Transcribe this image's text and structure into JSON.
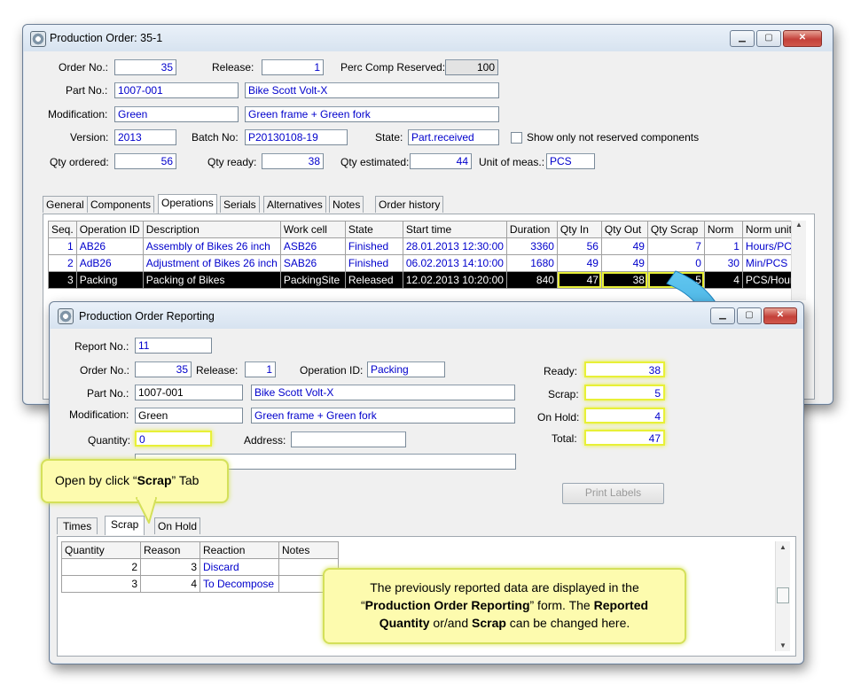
{
  "main_window": {
    "title": "Production Order: 35-1",
    "labels": {
      "order_no": "Order No.:",
      "release": "Release:",
      "perc_comp_reserved": "Perc Comp Reserved:",
      "part_no": "Part No.:",
      "modification": "Modification:",
      "version": "Version:",
      "batch_no": "Batch No:",
      "state": "State:",
      "show_only": "Show only not reserved components",
      "qty_ordered": "Qty ordered:",
      "qty_ready": "Qty ready:",
      "qty_estimated": "Qty estimated:",
      "unit_of_meas": "Unit of meas.:"
    },
    "values": {
      "order_no": "35",
      "release": "1",
      "perc_comp_reserved": "100",
      "part_no": "1007-001",
      "part_desc": "Bike Scott Volt-X",
      "modification": "Green",
      "modification_desc": "Green frame + Green fork",
      "version": "2013",
      "batch_no": "P20130108-19",
      "state": "Part.received",
      "qty_ordered": "56",
      "qty_ready": "38",
      "qty_estimated": "44",
      "unit_of_meas": "PCS"
    },
    "tabs": [
      "General",
      "Components",
      "Operations",
      "Serials",
      "Alternatives",
      "Notes",
      "Order history"
    ],
    "active_tab": "Operations",
    "ops_columns": [
      "Seq.",
      "Operation ID",
      "Description",
      "Work cell",
      "State",
      "Start time",
      "Duration",
      "Qty In",
      "Qty Out",
      "Qty Scrap",
      "Norm",
      "Norm unit"
    ],
    "ops_rows": [
      [
        "1",
        "AB26",
        "Assembly of Bikes 26 inch",
        "ASB26",
        "Finished",
        "28.01.2013 12:30:00",
        "3360",
        "56",
        "49",
        "7",
        "1",
        "Hours/PCS"
      ],
      [
        "2",
        "AdB26",
        "Adjustment of Bikes 26 inch",
        "SAB26",
        "Finished",
        "06.02.2013 14:10:00",
        "1680",
        "49",
        "49",
        "0",
        "30",
        "Min/PCS"
      ],
      [
        "3",
        "Packing",
        "Packing of Bikes",
        "PackingSite",
        "Released",
        "12.02.2013 10:20:00",
        "840",
        "47",
        "38",
        "5",
        "4",
        "PCS/Hour"
      ]
    ]
  },
  "report_window": {
    "title": "Production Order Reporting",
    "labels": {
      "report_no": "Report No.:",
      "order_no": "Order No.:",
      "release": "Release:",
      "operation_id": "Operation ID:",
      "part_no": "Part No.:",
      "modification": "Modification:",
      "quantity": "Quantity:",
      "address": "Address:",
      "ready": "Ready:",
      "scrap": "Scrap:",
      "on_hold": "On Hold:",
      "total": "Total:"
    },
    "values": {
      "report_no": "11",
      "order_no": "35",
      "release": "1",
      "operation_id": "Packing",
      "part_no": "1007-001",
      "part_desc": "Bike Scott Volt-X",
      "modification": "Green",
      "modification_desc": "Green frame + Green fork",
      "quantity": "0",
      "address": "",
      "ready": "38",
      "scrap": "5",
      "on_hold": "4",
      "total": "47"
    },
    "print_labels": "Print Labels",
    "tabs": [
      "Times",
      "Scrap",
      "On Hold"
    ],
    "active_tab": "Scrap",
    "scrap_columns": [
      "Quantity",
      "Reason",
      "Reaction",
      "Notes"
    ],
    "scrap_rows": [
      [
        "2",
        "3",
        "Discard",
        ""
      ],
      [
        "3",
        "4",
        "To Decompose",
        ""
      ]
    ]
  },
  "callouts": {
    "tab_hint_prefix": "Open by click “",
    "tab_hint_bold": "Scrap",
    "tab_hint_suffix": "” Tab",
    "info_1": "The previously reported data are displayed in the",
    "info_2a": "“",
    "info_2b": "Production Order Reporting",
    "info_2c": "” form. The ",
    "info_2d": "Reported",
    "info_3a": "Quantity",
    "info_3b": " or/and ",
    "info_3c": "Scrap",
    "info_3d": " can be changed here."
  },
  "colors": {
    "highlight": "#e8f037",
    "field_text": "#0000cc",
    "callout_bg": "#fdfbae",
    "arrow": "#2aa7de"
  }
}
